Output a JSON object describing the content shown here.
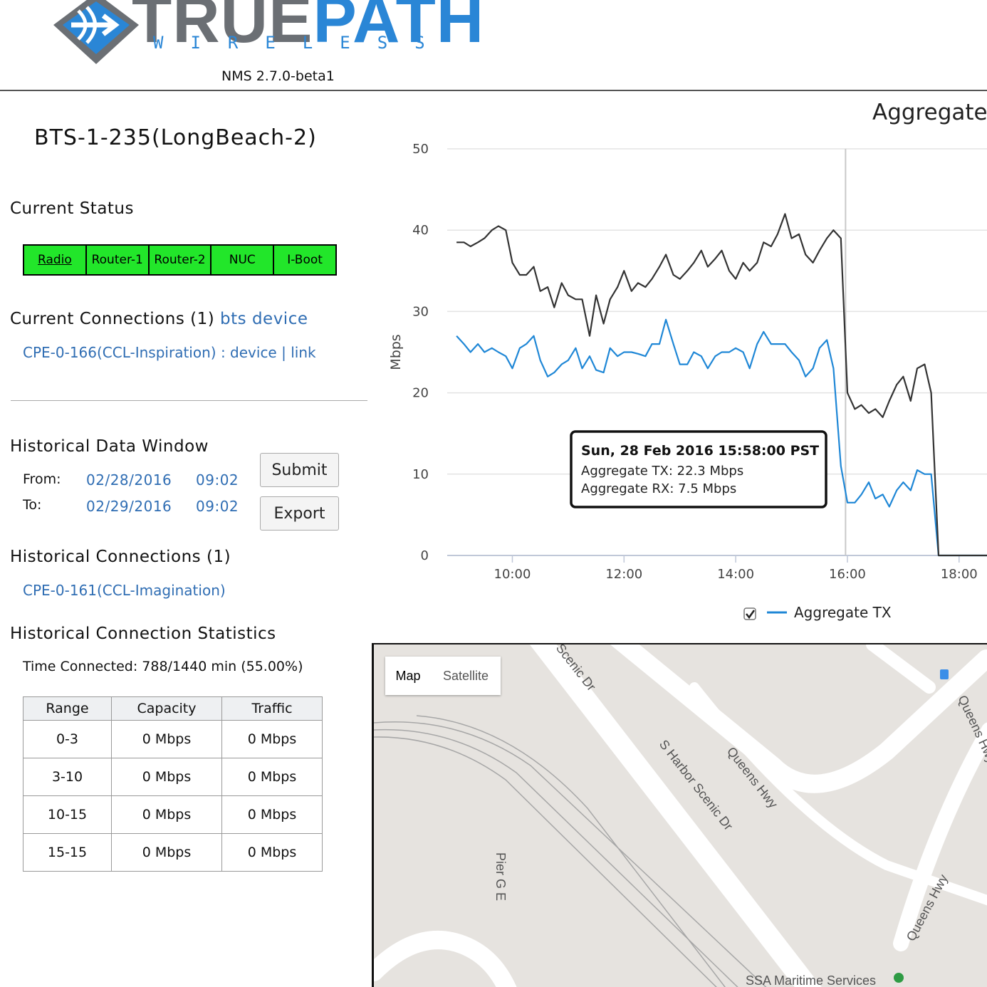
{
  "header": {
    "logo_word_1": "TRUE",
    "logo_word_2": "PATH",
    "logo_sub": "WIRELESS",
    "version": "NMS 2.7.0-beta1",
    "brand_color": "#2a86d6"
  },
  "device": {
    "title": "BTS-1-235(LongBeach-2)"
  },
  "current_status": {
    "title": "Current Status",
    "items": [
      {
        "label": "Radio",
        "color": "#22e62a"
      },
      {
        "label": "Router-1",
        "color": "#22e62a"
      },
      {
        "label": "Router-2",
        "color": "#22e62a"
      },
      {
        "label": "NUC",
        "color": "#22e62a"
      },
      {
        "label": "I-Boot",
        "color": "#22e62a"
      }
    ]
  },
  "current_connections": {
    "title": "Current Connections (1)",
    "bts_link": "bts device",
    "cpe": "CPE-0-166(CCL-Inspiration)",
    "sep1": ":",
    "device_link": "device",
    "sep2": "|",
    "link_link": "link"
  },
  "historical_window": {
    "title": "Historical Data Window",
    "from_label": "From:",
    "from_date": "02/28/2016",
    "from_time": "09:02",
    "to_label": "To:",
    "to_date": "02/29/2016",
    "to_time": "09:02",
    "submit": "Submit",
    "export": "Export"
  },
  "historical_connections": {
    "title": "Historical Connections (1)",
    "cpe": "CPE-0-161(CCL-Imagination)"
  },
  "statistics": {
    "title": "Historical Connection Statistics",
    "time_connected": "Time Connected: 788/1440 min (55.00%)",
    "headers": [
      "Range",
      "Capacity",
      "Traffic"
    ],
    "rows": [
      [
        "0-3",
        "0 Mbps",
        "0 Mbps"
      ],
      [
        "3-10",
        "0 Mbps",
        "0 Mbps"
      ],
      [
        "10-15",
        "0 Mbps",
        "0 Mbps"
      ],
      [
        "15-15",
        "0 Mbps",
        "0 Mbps"
      ]
    ]
  },
  "chart_data": {
    "type": "line",
    "title": "Aggregate",
    "ylabel": "Mbps",
    "ylim": [
      0,
      50
    ],
    "yticks": [
      0,
      10,
      20,
      30,
      40,
      50
    ],
    "xlim": [
      "08:50",
      "18:30"
    ],
    "xticks": [
      "10:00",
      "12:00",
      "14:00",
      "16:00",
      "18:00"
    ],
    "series": [
      {
        "name": "Aggregate TX",
        "color": "#1f87d6",
        "x": [
          "09:00",
          "09:08",
          "09:15",
          "09:23",
          "09:30",
          "09:38",
          "09:45",
          "09:53",
          "10:00",
          "10:08",
          "10:15",
          "10:23",
          "10:30",
          "10:38",
          "10:45",
          "10:53",
          "11:00",
          "11:08",
          "11:15",
          "11:23",
          "11:30",
          "11:38",
          "11:45",
          "11:53",
          "12:00",
          "12:08",
          "12:15",
          "12:23",
          "12:30",
          "12:38",
          "12:45",
          "12:53",
          "13:00",
          "13:08",
          "13:15",
          "13:23",
          "13:30",
          "13:38",
          "13:45",
          "13:53",
          "14:00",
          "14:08",
          "14:15",
          "14:23",
          "14:30",
          "14:38",
          "14:45",
          "14:53",
          "15:00",
          "15:08",
          "15:15",
          "15:23",
          "15:30",
          "15:38",
          "15:45",
          "15:53",
          "16:00",
          "16:08",
          "16:15",
          "16:23",
          "16:30",
          "16:38",
          "16:45",
          "16:53",
          "17:00",
          "17:08",
          "17:15",
          "17:23",
          "17:30",
          "17:38",
          "17:45",
          "17:53",
          "18:00",
          "18:08",
          "18:15",
          "18:30"
        ],
        "values": [
          27,
          26,
          25,
          26,
          25,
          25.5,
          25,
          24.5,
          23,
          25.5,
          26,
          27,
          24,
          22,
          22.5,
          23.5,
          24,
          25.5,
          23,
          24.5,
          22.8,
          22.5,
          25.5,
          24.5,
          25,
          25,
          24.8,
          24.5,
          26,
          26,
          29,
          26,
          23.5,
          23.5,
          25,
          24.5,
          23,
          24.5,
          25,
          25,
          25.5,
          25,
          23,
          26,
          27.5,
          26,
          26,
          26,
          25,
          24,
          22,
          23,
          25.5,
          26.5,
          23,
          11,
          6.5,
          6.5,
          7.5,
          9,
          7,
          7.5,
          6,
          8,
          9,
          8,
          10.5,
          10,
          10,
          0,
          0,
          0,
          0,
          0,
          0,
          0
        ]
      },
      {
        "name": "Aggregate RX",
        "color": "#333333",
        "x": [
          "09:00",
          "09:08",
          "09:15",
          "09:23",
          "09:30",
          "09:38",
          "09:45",
          "09:53",
          "10:00",
          "10:08",
          "10:15",
          "10:23",
          "10:30",
          "10:38",
          "10:45",
          "10:53",
          "11:00",
          "11:08",
          "11:15",
          "11:23",
          "11:30",
          "11:38",
          "11:45",
          "11:53",
          "12:00",
          "12:08",
          "12:15",
          "12:23",
          "12:30",
          "12:38",
          "12:45",
          "12:53",
          "13:00",
          "13:08",
          "13:15",
          "13:23",
          "13:30",
          "13:38",
          "13:45",
          "13:53",
          "14:00",
          "14:08",
          "14:15",
          "14:23",
          "14:30",
          "14:38",
          "14:45",
          "14:53",
          "15:00",
          "15:08",
          "15:15",
          "15:23",
          "15:30",
          "15:38",
          "15:45",
          "15:53",
          "16:00",
          "16:08",
          "16:15",
          "16:23",
          "16:30",
          "16:38",
          "16:45",
          "16:53",
          "17:00",
          "17:08",
          "17:15",
          "17:23",
          "17:30",
          "17:38",
          "17:45",
          "17:53",
          "18:00",
          "18:08",
          "18:15",
          "18:30"
        ],
        "values": [
          38.5,
          38.5,
          38,
          38.5,
          39,
          40,
          40.5,
          40,
          36,
          34.5,
          34.5,
          35.5,
          32.5,
          33,
          30.5,
          33.5,
          32,
          31.5,
          31.5,
          27,
          32,
          28.5,
          31.5,
          33,
          35,
          32.5,
          33.5,
          33,
          34,
          35.5,
          37,
          34.5,
          34,
          35,
          36,
          37.5,
          35.5,
          36.5,
          37.5,
          35,
          34,
          36,
          35,
          36,
          38.5,
          38,
          39.5,
          42,
          39,
          39.5,
          37,
          36,
          37.5,
          39,
          40,
          39,
          20,
          18,
          18.5,
          17.5,
          18,
          17,
          19,
          21,
          22,
          19,
          23,
          23.5,
          20,
          0,
          0,
          0,
          0,
          0,
          0,
          0
        ]
      }
    ],
    "legend": [
      {
        "label": "Aggregate TX",
        "checked": true
      }
    ],
    "crosshair_x": "15:58",
    "tooltip": {
      "title": "Sun, 28 Feb 2016 15:58:00 PST",
      "line1": "Aggregate TX: 22.3 Mbps",
      "line2": "Aggregate RX: 7.5 Mbps"
    }
  },
  "map": {
    "map_label": "Map",
    "satellite_label": "Satellite",
    "labels": {
      "scenic_dr": "Scenic Dr",
      "s_harbor": "S Harbor Scenic Dr",
      "queens_hwy_1": "Queens Hwy",
      "queens_hwy_2": "Queens Hwy",
      "queens_hwy_3": "Queens Hwy",
      "pier_g": "Pier G E",
      "ssa": "SSA Maritime Services"
    }
  }
}
